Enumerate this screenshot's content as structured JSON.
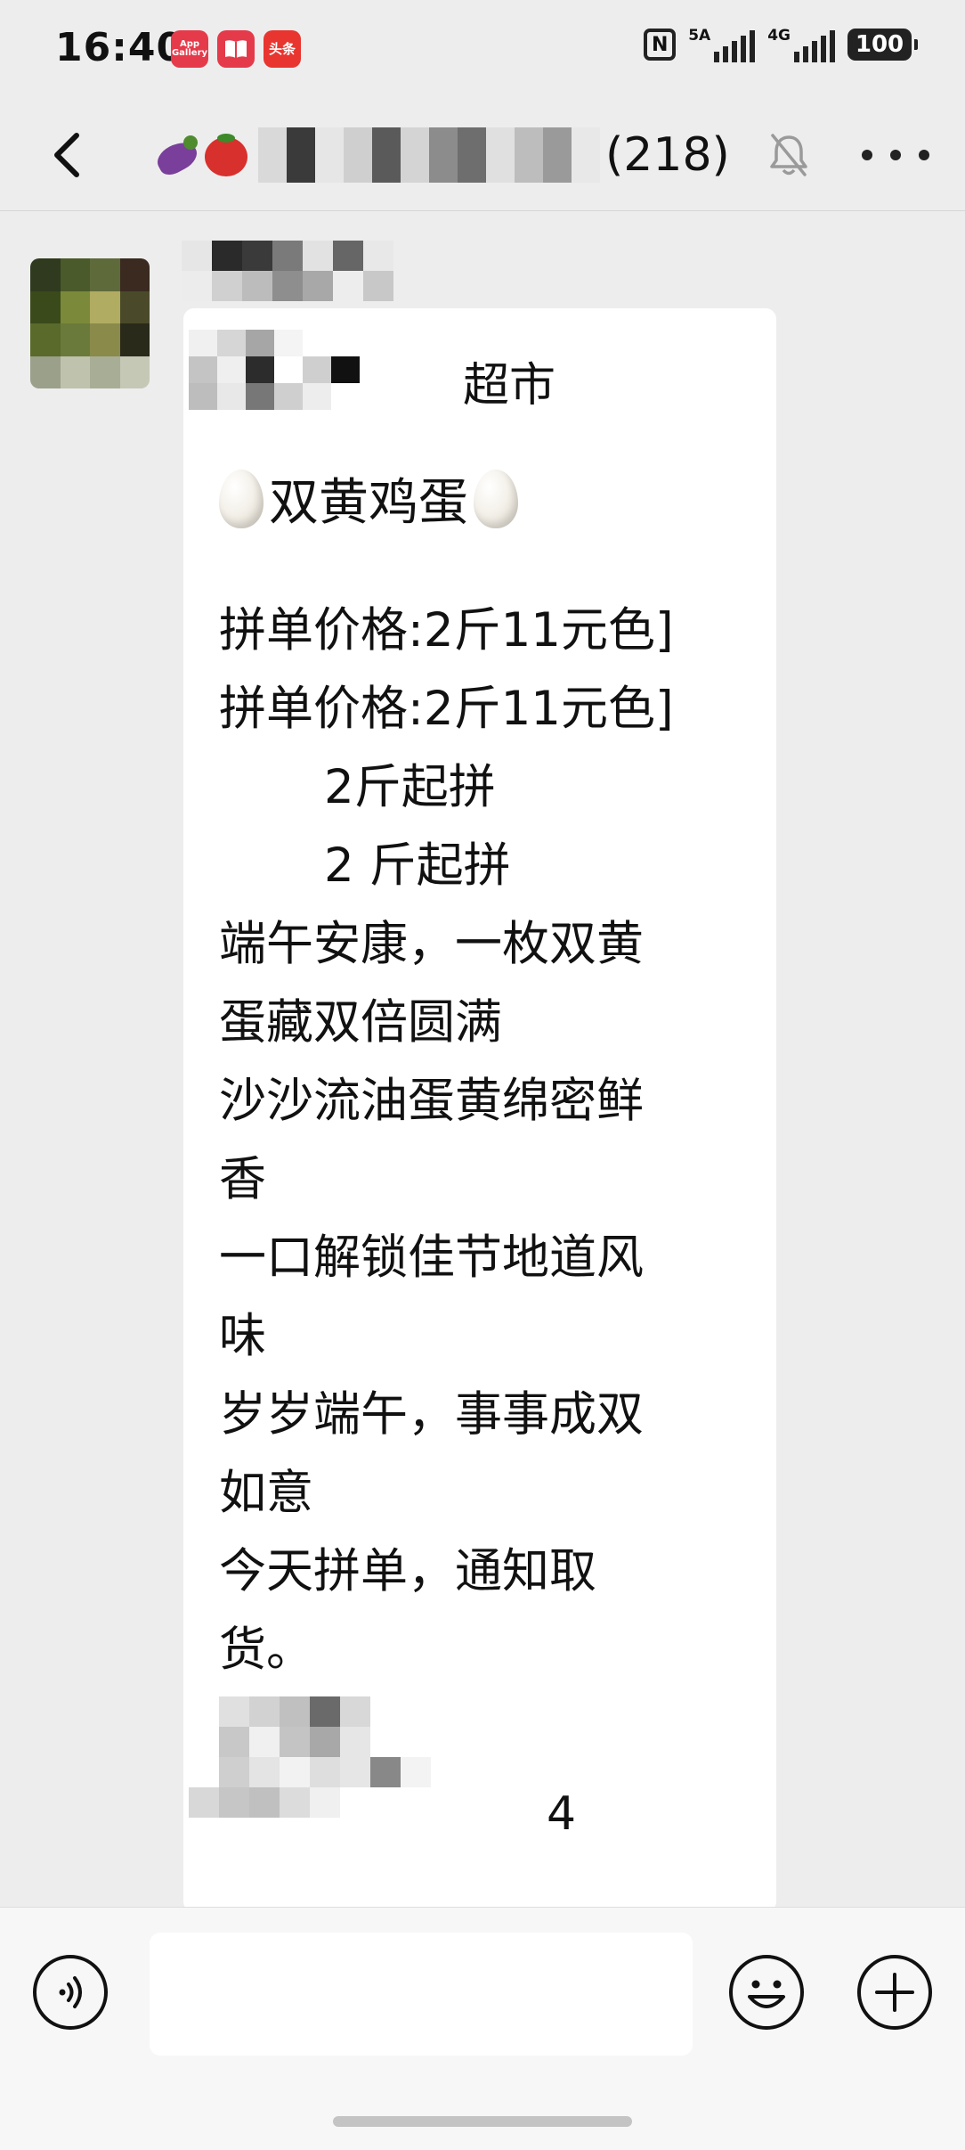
{
  "status_bar": {
    "time": "16:40",
    "app_icons": [
      {
        "name": "app-gallery-icon",
        "label": "App Gallery"
      },
      {
        "name": "books-icon",
        "label": ""
      },
      {
        "name": "toutiao-icon",
        "label": "头条"
      }
    ],
    "signal_1_label": "5A",
    "signal_2_label": "4G",
    "battery": "100"
  },
  "header": {
    "back_icon": "chevron-left-icon",
    "title_emojis": [
      "eggplant-icon",
      "tomato-icon"
    ],
    "title_count": "(218)",
    "mute_icon": "bell-off-icon",
    "more_icon": "more-dots-icon"
  },
  "message": {
    "shop_name": "超市",
    "title": "双黄鸡蛋",
    "price_line_1": "拼单价格:2斤11元色]",
    "price_line_2": "拼单价格:2斤11元色]",
    "min_line_1": "2斤起拼",
    "min_line_2": "2 斤起拼",
    "body_lines": [
      "端午安康，一枚双黄",
      "蛋藏双倍圆满",
      "沙沙流油蛋黄绵密鲜",
      "香",
      "一口解锁佳节地道风",
      "味",
      "岁岁端午，事事成双",
      "如意",
      "今天拼单，通知取",
      "货。"
    ],
    "partial_tail": "4"
  },
  "input_bar": {
    "voice_icon": "voice-icon",
    "input_value": "",
    "emoji_icon": "smiley-icon",
    "plus_icon": "plus-icon"
  },
  "colors": {
    "background": "#ededed",
    "bubble": "#ffffff",
    "input_bar": "#f7f7f7"
  }
}
